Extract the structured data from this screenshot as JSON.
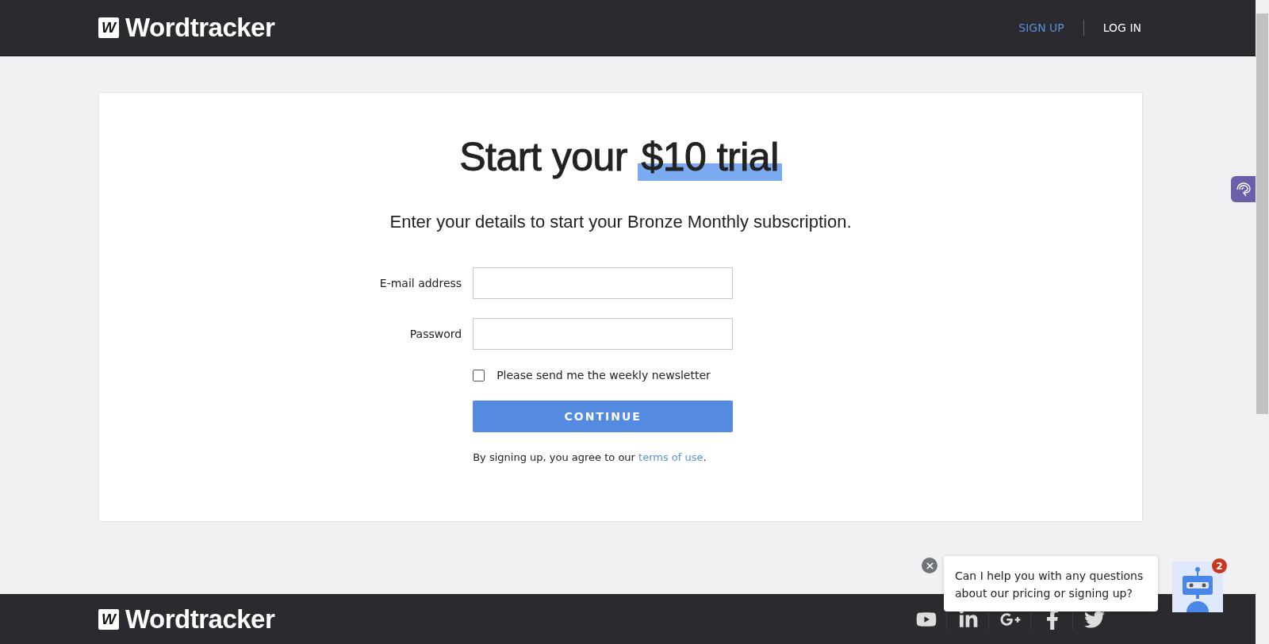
{
  "header": {
    "logo_mark": "W",
    "logo_text": "Wordtracker",
    "nav": [
      {
        "label": "SIGN UP",
        "selected": true
      },
      {
        "label": "LOG IN",
        "selected": false
      }
    ]
  },
  "signup": {
    "title": {
      "text": "Start your",
      "highlight": "$10 trial"
    },
    "subtitle": "Enter your details to start your Bronze Monthly subscription.",
    "fields": [
      {
        "label": "E-mail address"
      },
      {
        "label": "Password"
      }
    ],
    "newsletter": {
      "label": "Please send me the weekly newsletter",
      "checked": false
    },
    "submit": "CONTINUE",
    "terms": {
      "text": "By signing up, you agree to our",
      "link": "terms of use",
      "end": "."
    }
  },
  "footer": {
    "logo_mark": "W",
    "logo_text": "Wordtracker"
  },
  "chat": {
    "message": "Can I help you with any questions about our pricing or signing up?",
    "badge": "2"
  }
}
